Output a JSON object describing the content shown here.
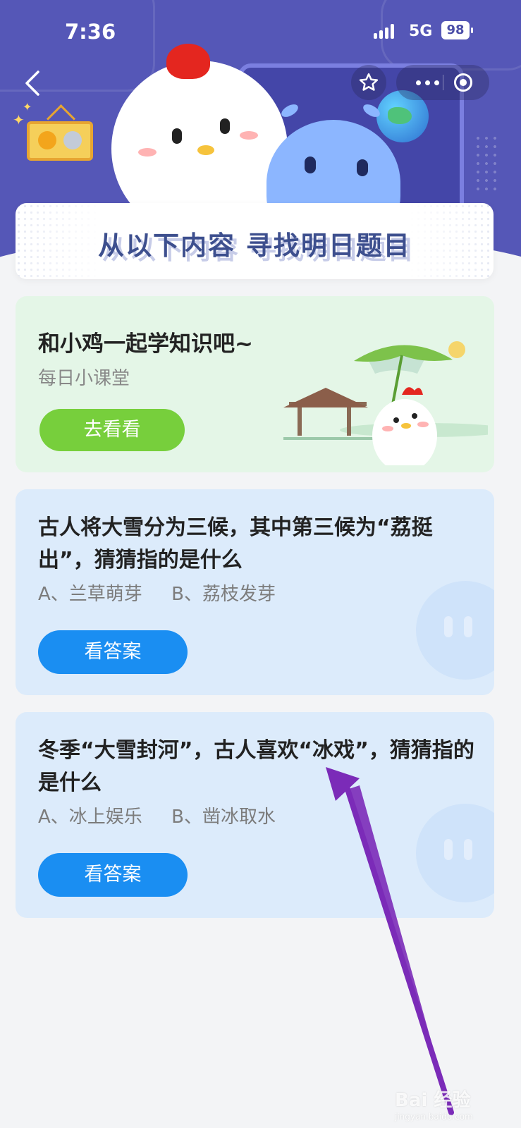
{
  "status_bar": {
    "time": "7:36",
    "network": "5G",
    "battery": "98"
  },
  "header": {
    "banner_title": "从以下内容 寻找明日题目"
  },
  "lesson_card": {
    "title": "和小鸡一起学知识吧~",
    "subtitle": "每日小课堂",
    "button_label": "去看看"
  },
  "questions": [
    {
      "text": "古人将大雪分为三候，其中第三候为“荔挺出”，猜猜指的是什么",
      "options": "A、兰草萌芽     B、荔枝发芽",
      "button_label": "看答案"
    },
    {
      "text": "冬季“大雪封河”，古人喜欢“冰戏”，猜猜指的是什么",
      "options": "A、冰上娱乐     B、凿冰取水",
      "button_label": "看答案"
    }
  ],
  "watermark": {
    "brand": "Bai 经验",
    "url": "jingyan.baidu.com"
  },
  "colors": {
    "header_bg": "#5557b7",
    "green_button": "#77cf3c",
    "blue_button": "#1a8ef2",
    "annotation_arrow": "#7b2bb8"
  },
  "icons": [
    "back-icon",
    "star-icon",
    "more-dots-icon",
    "target-icon",
    "signal-icon",
    "battery-icon"
  ]
}
